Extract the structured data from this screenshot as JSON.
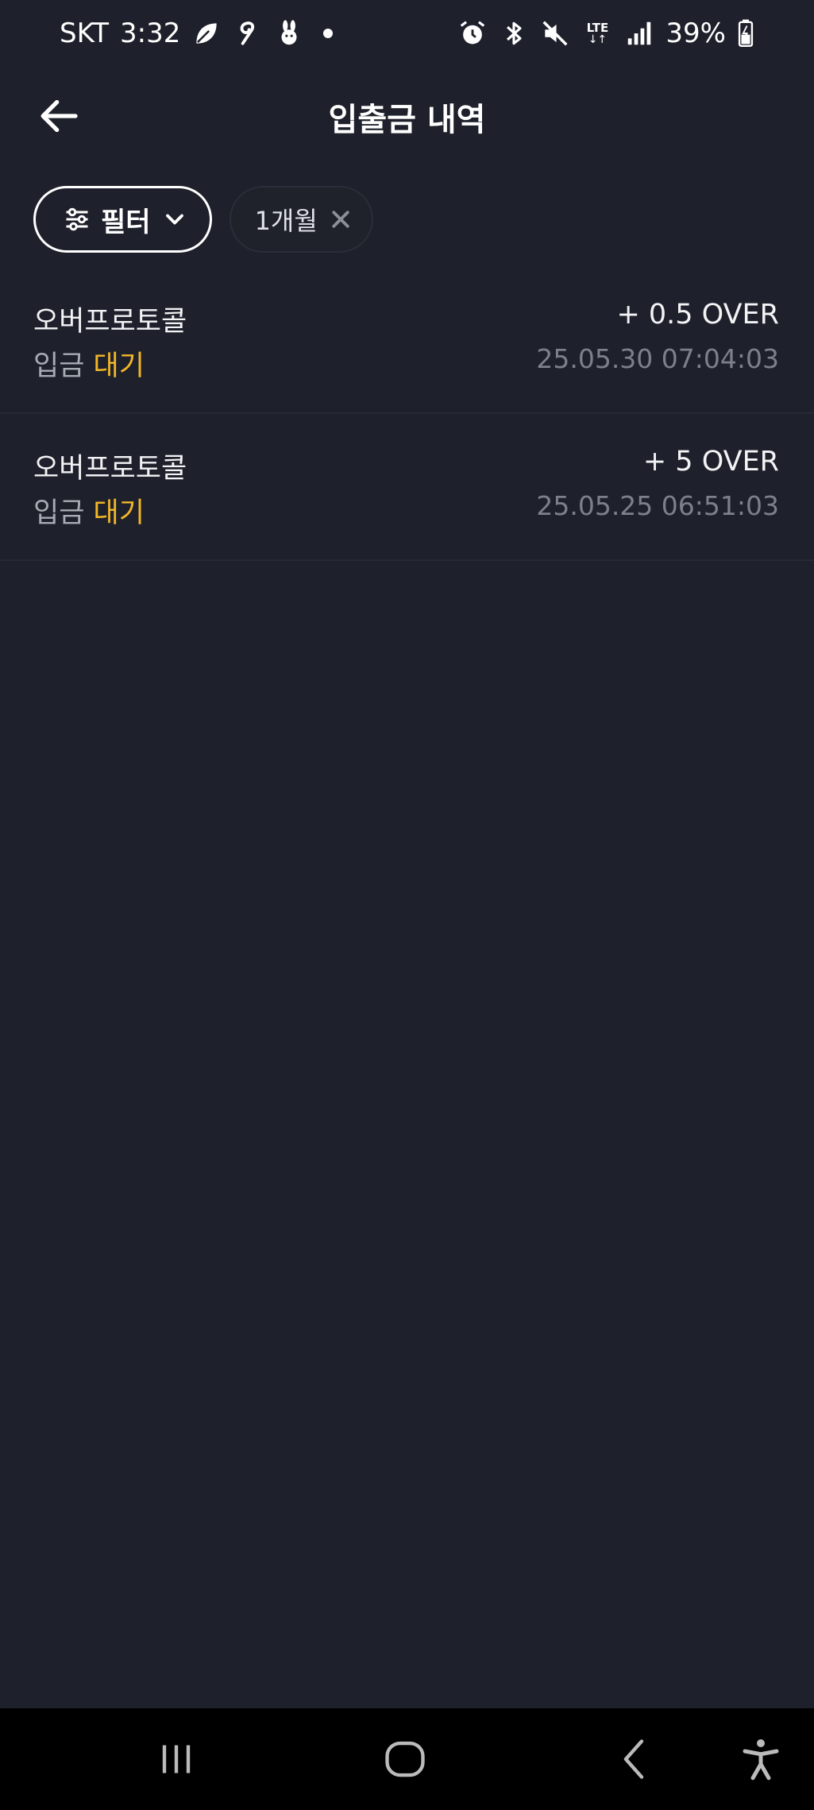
{
  "status_bar": {
    "carrier": "SKT",
    "time": "3:32",
    "left_icons": [
      "leaf-icon",
      "swirl-icon",
      "rabbit-icon",
      "dot-icon"
    ],
    "right_icons": [
      "alarm-icon",
      "bluetooth-icon",
      "mute-icon",
      "lte-icon",
      "signal-icon",
      "battery-icon"
    ],
    "network": "LTE",
    "battery": "39%"
  },
  "header": {
    "title": "입출금 내역",
    "back_icon": "back-arrow-icon"
  },
  "filters": {
    "filter_label": "필터",
    "filter_icon": "sliders-icon",
    "chevron_icon": "chevron-down-icon",
    "chip_label": "1개월",
    "chip_close_icon": "close-icon"
  },
  "transactions": [
    {
      "name": "오버프로토콜",
      "type": "입금",
      "status": "대기",
      "amount": "+ 0.5 OVER",
      "datetime": "25.05.30 07:04:03"
    },
    {
      "name": "오버프로토콜",
      "type": "입금",
      "status": "대기",
      "amount": "+ 5 OVER",
      "datetime": "25.05.25 06:51:03"
    }
  ],
  "colors": {
    "background": "#1e212b",
    "pending": "#f4b728",
    "nav_bar": "#000000"
  },
  "nav_bar": {
    "icons": [
      "recent-apps-icon",
      "home-icon",
      "back-icon",
      "accessibility-icon"
    ]
  }
}
